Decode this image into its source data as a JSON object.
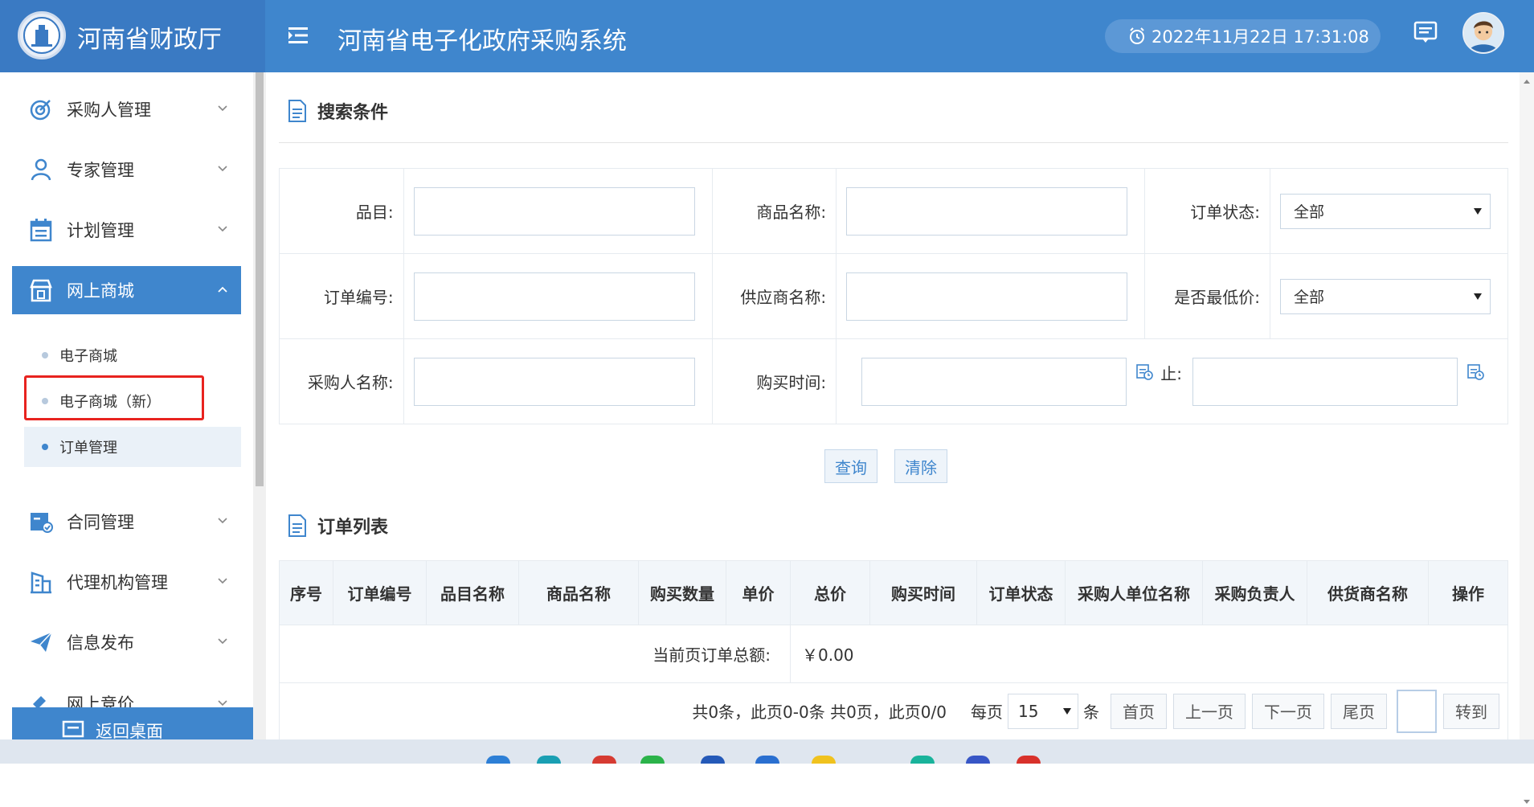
{
  "header": {
    "brand_title": "河南省财政厅",
    "system_title": "河南省电子化政府采购系统",
    "datetime": "2022年11月22日 17:31:08"
  },
  "sidebar": {
    "items": [
      {
        "label": "采购人管理",
        "icon": "target-icon"
      },
      {
        "label": "专家管理",
        "icon": "person-icon"
      },
      {
        "label": "计划管理",
        "icon": "calendar-icon"
      },
      {
        "label": "网上商城",
        "icon": "shop-icon",
        "active": true
      },
      {
        "label": "合同管理",
        "icon": "contract-icon"
      },
      {
        "label": "代理机构管理",
        "icon": "building-icon"
      },
      {
        "label": "信息发布",
        "icon": "send-icon"
      },
      {
        "label": "网上竞价",
        "icon": "hammer-icon"
      }
    ],
    "sub_items": [
      {
        "label": "电子商城"
      },
      {
        "label": "电子商城（新）",
        "highlighted": true
      },
      {
        "label": "订单管理",
        "current": true
      }
    ],
    "back_button": "返回桌面"
  },
  "search": {
    "title": "搜索条件",
    "fields": {
      "category": "品目:",
      "product_name": "商品名称:",
      "order_status": "订单状态:",
      "order_no": "订单编号:",
      "supplier_name": "供应商名称:",
      "lowest_price": "是否最低价:",
      "buyer_name": "采购人名称:",
      "purchase_time": "购买时间:",
      "to": "止:"
    },
    "order_status_value": "全部",
    "lowest_price_value": "全部",
    "query_button": "查询",
    "clear_button": "清除"
  },
  "orders": {
    "title": "订单列表",
    "columns": [
      "序号",
      "订单编号",
      "品目名称",
      "商品名称",
      "购买数量",
      "单价",
      "总价",
      "购买时间",
      "订单状态",
      "采购人单位名称",
      "采购负责人",
      "供货商名称",
      "操作"
    ],
    "total_label": "当前页订单总额:",
    "total_value": "￥0.00"
  },
  "pager": {
    "summary": "共0条，此页0-0条 共0页，此页0/0",
    "per_page_label": "每页",
    "per_page_value": "15",
    "per_page_unit": "条",
    "first": "首页",
    "prev": "上一页",
    "next": "下一页",
    "last": "尾页",
    "go": "转到"
  },
  "colors": {
    "primary": "#3f86cd",
    "brand_bg": "#3a7ac3",
    "highlight_red": "#e8231f"
  }
}
